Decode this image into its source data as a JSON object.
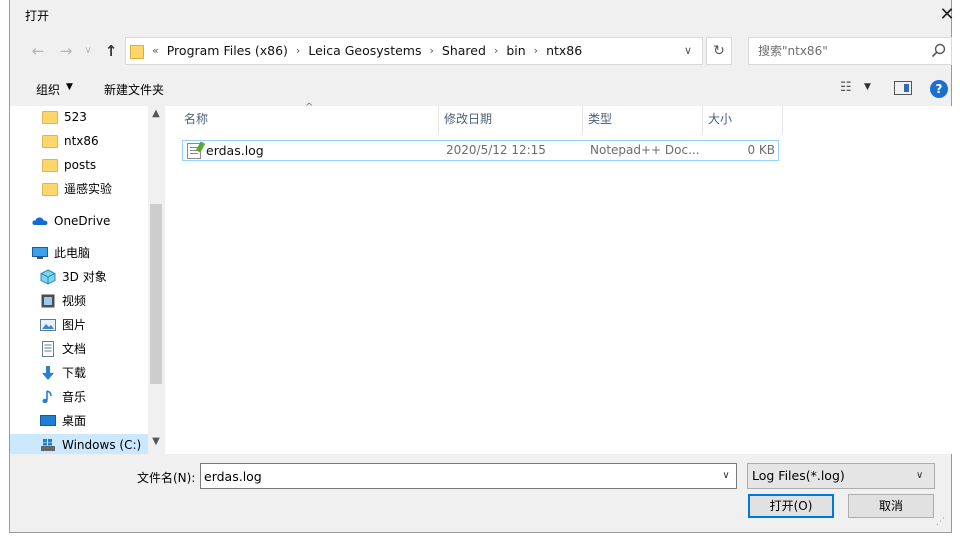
{
  "dialog": {
    "title": "打开",
    "close_glyph": "✕"
  },
  "nav": {
    "back_glyph": "←",
    "forward_glyph": "→",
    "recent_glyph": "∨",
    "up_glyph": "↑"
  },
  "address": {
    "overflow": "«",
    "crumbs": [
      "Program Files (x86)",
      "Leica Geosystems",
      "Shared",
      "bin",
      "ntx86"
    ],
    "separator": "›",
    "dropdown_glyph": "∨",
    "refresh_glyph": "↻"
  },
  "search": {
    "placeholder": "搜索\"ntx86\"",
    "icon": "search-icon"
  },
  "toolbar": {
    "organize_label": "组织",
    "organize_arrow": "▼",
    "new_folder_label": "新建文件夹",
    "view_glyph": "☷",
    "view_arrow": "▼",
    "help_glyph": "?"
  },
  "tree": {
    "items": [
      {
        "label": "523",
        "icon": "folder-icon"
      },
      {
        "label": "ntx86",
        "icon": "folder-icon"
      },
      {
        "label": "posts",
        "icon": "folder-icon"
      },
      {
        "label": "遥感实验",
        "icon": "folder-icon"
      },
      {
        "label": "OneDrive",
        "icon": "cloud-icon"
      },
      {
        "label": "此电脑",
        "icon": "computer-icon"
      },
      {
        "label": "3D 对象",
        "icon": "cube-icon"
      },
      {
        "label": "视频",
        "icon": "video-icon"
      },
      {
        "label": "图片",
        "icon": "picture-icon"
      },
      {
        "label": "文档",
        "icon": "document-icon"
      },
      {
        "label": "下载",
        "icon": "download-icon"
      },
      {
        "label": "音乐",
        "icon": "music-icon"
      },
      {
        "label": "桌面",
        "icon": "desktop-icon"
      },
      {
        "label": "Windows (C:)",
        "icon": "drive-icon"
      }
    ],
    "scroll_up": "▲",
    "scroll_down": "▼"
  },
  "columns": {
    "name": "名称",
    "date": "修改日期",
    "type": "类型",
    "size": "大小",
    "sort_glyph": "^"
  },
  "files": [
    {
      "name": "erdas.log",
      "date": "2020/5/12 12:15",
      "type": "Notepad++ Doc...",
      "size": "0 KB"
    }
  ],
  "bottom": {
    "filename_label": "文件名(N):",
    "filename_value": "erdas.log",
    "filename_arrow": "∨",
    "filter_label": "Log Files(*.log)",
    "filter_arrow": "∨",
    "open_label": "打开(O)",
    "cancel_label": "取消",
    "grip": "⋰"
  },
  "colors": {
    "accent": "#0078d7",
    "selection": "#cce8ff",
    "header_text": "#4c607a",
    "folder": "#ffd66b"
  }
}
